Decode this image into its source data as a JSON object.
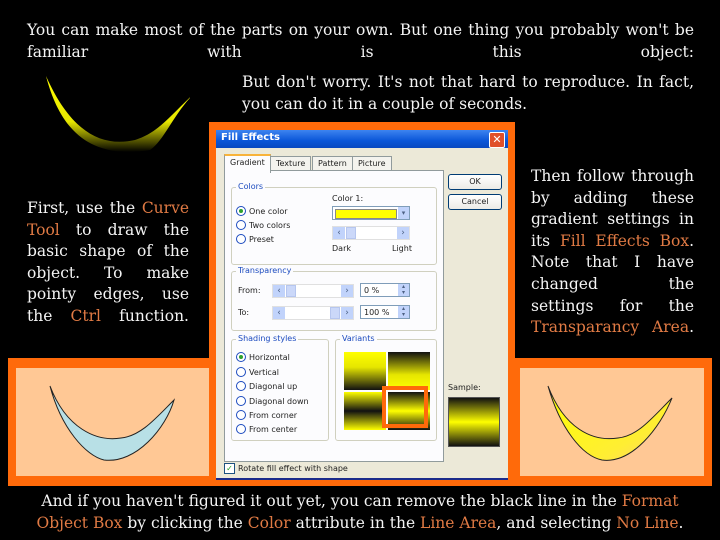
{
  "slide": {
    "intro": "You can make most of the parts on your own. But one thing you probably won't be familiar with is this object:",
    "reassure": "But don't worry. It's not that hard to reproduce. In fact, you can do it in a couple of seconds.",
    "left_text": {
      "p1": "First, use the ",
      "h1": "Curve Tool",
      "p2": " to draw the basic shape of the object. To make pointy edges, use the ",
      "h2": "Ctrl",
      "p3": " function."
    },
    "right_text": {
      "p1": "Then follow through by adding these gradient settings in its ",
      "h1": "Fill Effects Box",
      "p2": ". Note that I have changed the settings for the ",
      "h2": "Transparancy Area",
      "p3": "."
    },
    "bottom_text": {
      "p1": "And if you haven't figured it out yet, you can remove the black line in the ",
      "h1": "Format Object Box",
      "p2": " by clicking the ",
      "h2": "Color",
      "p3": " attribute in the ",
      "h3": "Line Area",
      "p4": ", and selecting ",
      "h4": "No Line",
      "p5": "."
    },
    "colors": {
      "accent": "#e07a44",
      "frame": "#ff6a0a",
      "panel": "#ffc895",
      "shape_fill_left": "#b8e0e6",
      "shape_fill_right": "#ffff00"
    }
  },
  "dialog": {
    "title": "Fill Effects",
    "close": "✕",
    "tabs": [
      "Gradient",
      "Texture",
      "Pattern",
      "Picture"
    ],
    "active_tab": "Gradient",
    "ok": "OK",
    "cancel": "Cancel",
    "colors_group": {
      "label": "Colors",
      "options": [
        "One color",
        "Two colors",
        "Preset"
      ],
      "selected": "One color",
      "color1_label": "Color 1:",
      "color1_value": "#ffff00",
      "dark_label": "Dark",
      "light_label": "Light"
    },
    "transparency": {
      "label": "Transparency",
      "from_label": "From:",
      "from_value": "0 %",
      "to_label": "To:",
      "to_value": "100 %"
    },
    "shading": {
      "label": "Shading styles",
      "options": [
        "Horizontal",
        "Vertical",
        "Diagonal up",
        "Diagonal down",
        "From corner",
        "From center"
      ],
      "selected": "Horizontal"
    },
    "variants": {
      "label": "Variants",
      "selected_index": 3
    },
    "sample_label": "Sample:",
    "rotate_label": "Rotate fill effect with shape",
    "rotate_checked": true
  }
}
